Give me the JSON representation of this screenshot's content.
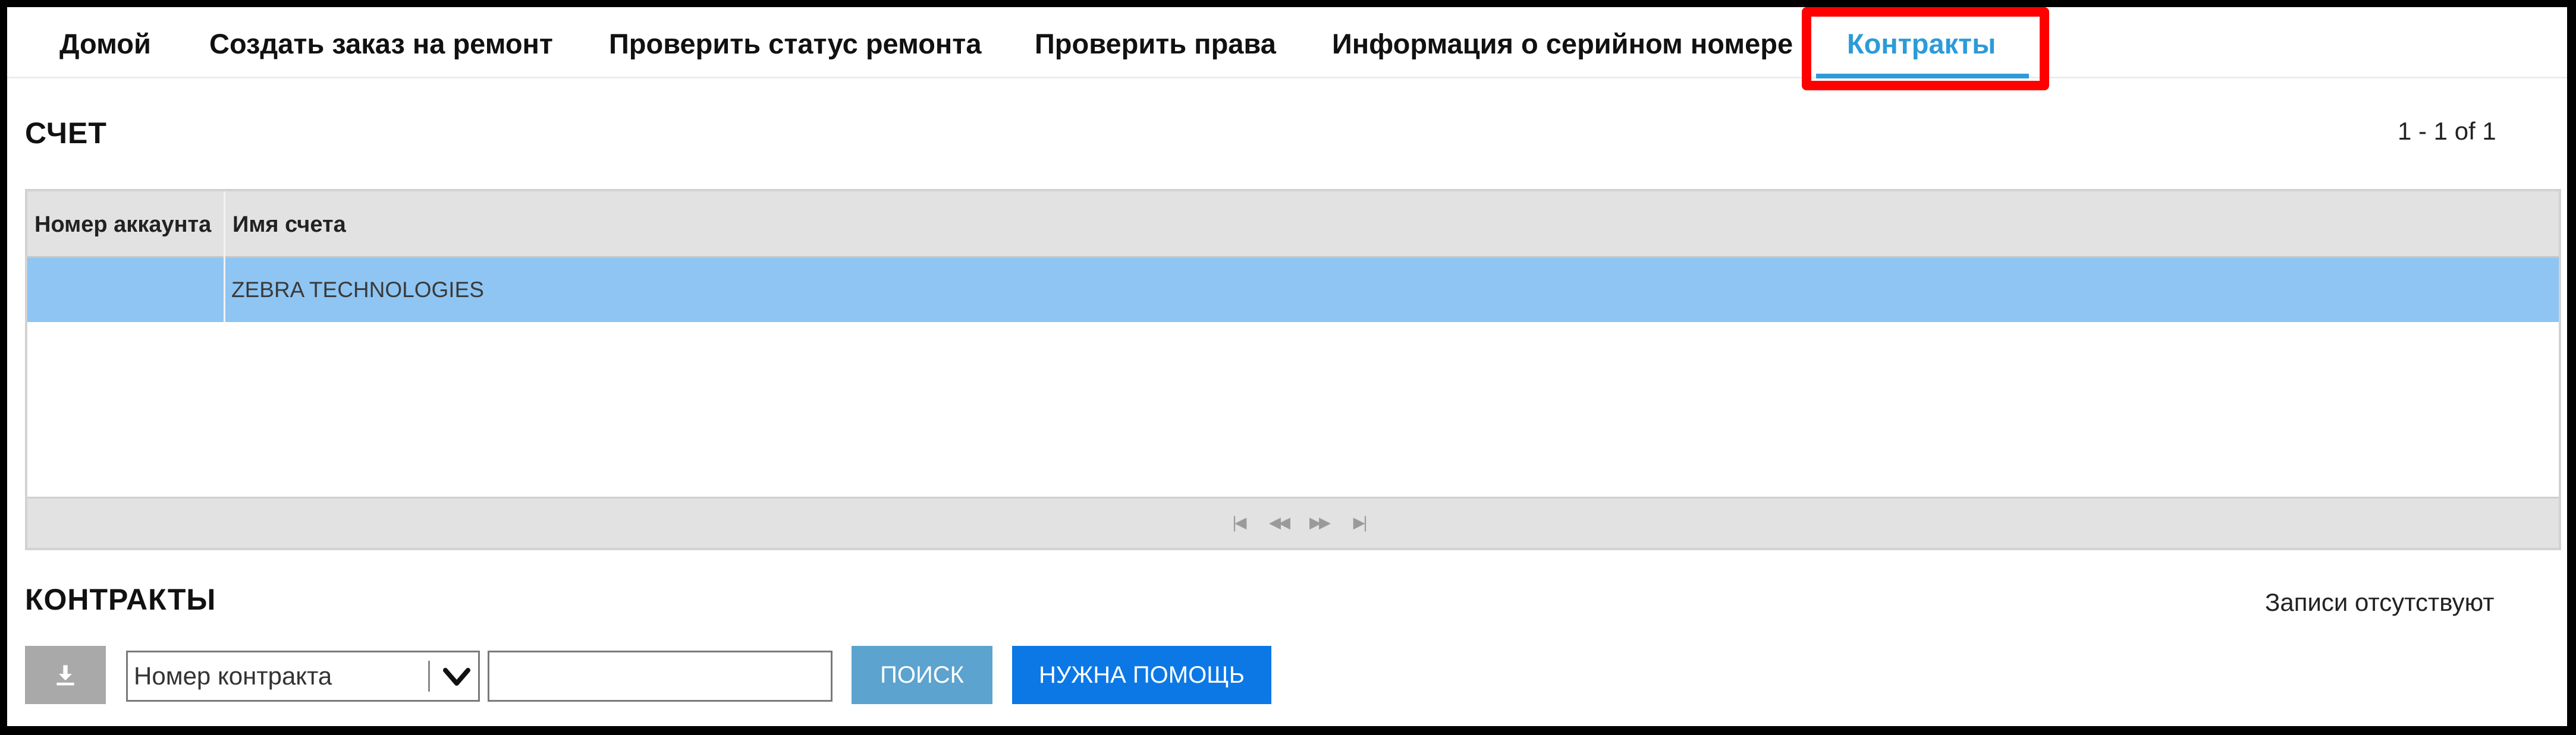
{
  "nav": {
    "tabs": [
      {
        "label": "Домой"
      },
      {
        "label": "Создать заказ на ремонт"
      },
      {
        "label": "Проверить статус ремонта"
      },
      {
        "label": "Проверить права"
      },
      {
        "label": "Информация о серийном номере"
      },
      {
        "label": "Контракты"
      }
    ],
    "active_tab": "Контракты",
    "highlight_color": "#ff0000",
    "active_color": "#2c9bd8"
  },
  "accounts": {
    "title": "СЧЕТ",
    "pagination": "1 - 1 of 1",
    "columns": [
      "Номер аккаунта",
      "Имя счета"
    ],
    "rows": [
      {
        "account_number": "",
        "account_name": "ZEBRA TECHNOLOGIES"
      }
    ],
    "selected_row_color": "#8ec5f3",
    "pager_icons": [
      "first-page-icon",
      "prev-page-icon",
      "next-page-icon",
      "last-page-icon"
    ]
  },
  "contracts": {
    "title": "КОНТРАКТЫ",
    "status": "Записи отсутствуют",
    "download_icon": "download-icon",
    "filter_select": {
      "selected": "Номер контракта"
    },
    "search_input": {
      "value": ""
    },
    "search_button": "ПОИСК",
    "help_button": "НУЖНА ПОМОЩЬ",
    "help_button_color": "#0c78e6"
  }
}
